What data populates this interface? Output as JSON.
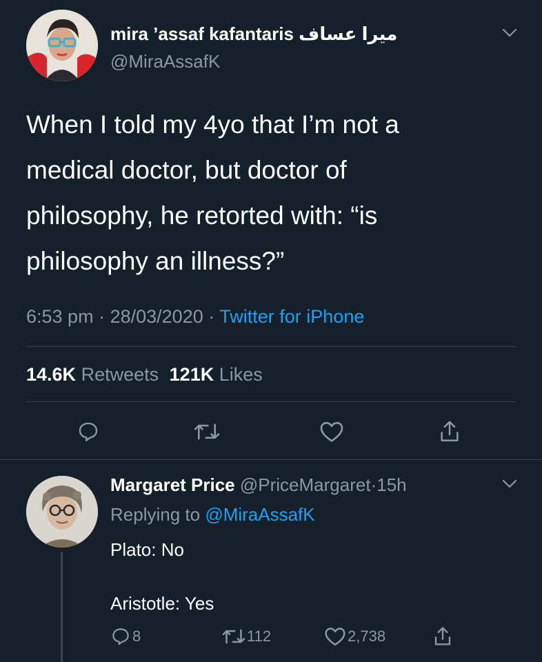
{
  "tweet": {
    "author_name": "mira ’assaf kafantaris ميرا عساف",
    "handle": "@MiraAssafK",
    "text_lines": [
      "When I told my 4yo that I’m not a",
      "medical doctor, but doctor of",
      "philosophy, he retorted with: “is",
      "philosophy an illness?”"
    ],
    "time": "6:53 pm",
    "date": "28/03/2020",
    "separator": "·",
    "source": "Twitter for iPhone",
    "retweets_count": "14.6K",
    "retweets_label": "Retweets",
    "likes_count": "121K",
    "likes_label": "Likes",
    "icons": [
      "reply-icon",
      "retweet-icon",
      "like-icon",
      "share-icon"
    ]
  },
  "reply": {
    "author_name": "Margaret Price",
    "handle": "@PriceMargaret",
    "separator": "·",
    "age": "15h",
    "replying_label": "Replying to",
    "replying_handle": "@MiraAssafK",
    "line1": "Plato: No",
    "line2": "Aristotle: Yes",
    "reply_count": "8",
    "retweet_count": "112",
    "like_count": "2,738"
  },
  "colors": {
    "background": "#15202b",
    "muted": "#8899a6",
    "accent": "#1da1f2",
    "divider": "#38444d"
  }
}
